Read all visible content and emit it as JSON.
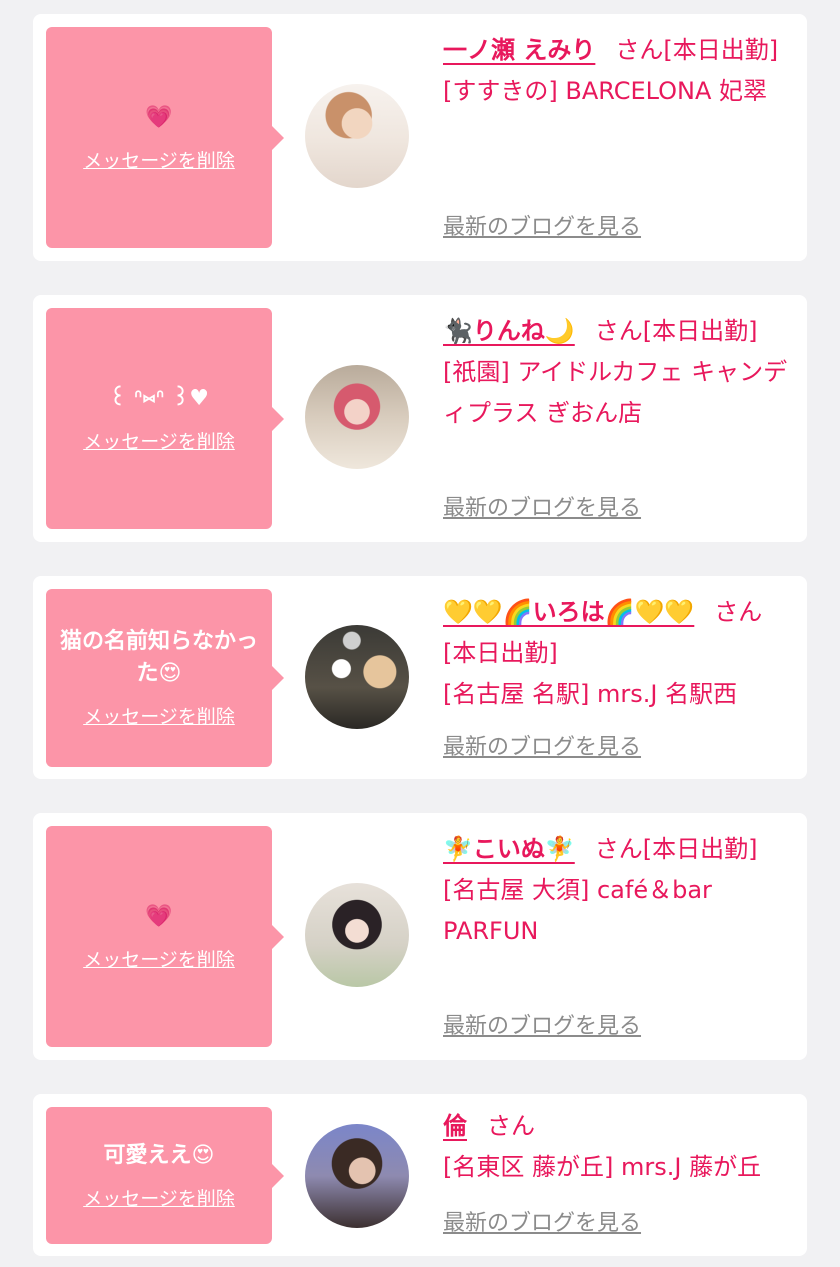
{
  "delete_label": "メッセージを削除",
  "blog_label": "最新のブログを見る",
  "honorific": "さん",
  "cards": [
    {
      "message": "💗",
      "name": "一ノ瀬 えみり",
      "status": "[本日出勤]",
      "shop": "[すすきの] BARCELONA 妃翠"
    },
    {
      "message": "꒰ ᐢ⑅ᐢ ꒱♥",
      "name": "🐈‍⬛りんね🌙",
      "status": "[本日出勤]",
      "shop": "[祇園] アイドルカフェ キャンディプラス ぎおん店"
    },
    {
      "message": "猫の名前知らなかった😍",
      "name": "💛💛🌈いろは🌈💛💛",
      "status": "[本日出勤]",
      "shop": "[名古屋 名駅] mrs.J 名駅西"
    },
    {
      "message": "💗",
      "name": "🧚こいぬ🧚",
      "status": "[本日出勤]",
      "shop": "[名古屋 大須] café＆bar PARFUN"
    },
    {
      "message": "可愛ええ😍",
      "name": "倫",
      "status": "",
      "shop": "[名東区 藤が丘] mrs.J 藤が丘"
    }
  ]
}
